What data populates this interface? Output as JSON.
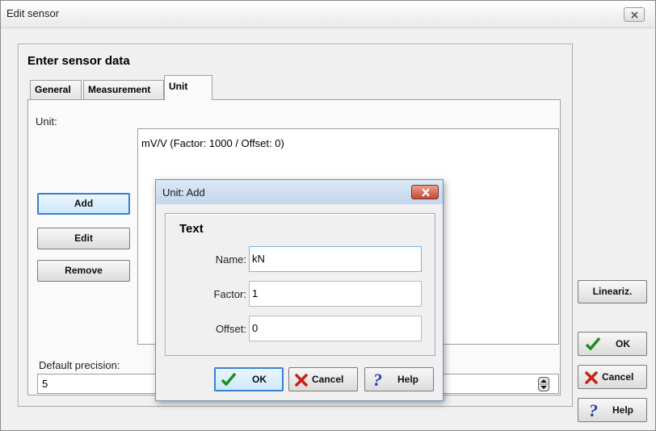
{
  "window": {
    "title": "Edit sensor"
  },
  "panel": {
    "heading": "Enter sensor data"
  },
  "tabs": [
    {
      "label": "General",
      "active": false
    },
    {
      "label": "Measurement",
      "active": false
    },
    {
      "label": "Unit",
      "active": true
    }
  ],
  "unit_tab": {
    "unit_label": "Unit:",
    "unit_list": [
      "mV/V (Factor: 1000 / Offset: 0)"
    ],
    "buttons": {
      "add": "Add",
      "edit": "Edit",
      "remove": "Remove"
    },
    "precision_label": "Default precision:",
    "precision_value": "5"
  },
  "side_buttons": {
    "lineariz": "Lineariz.",
    "ok": "OK",
    "cancel": "Cancel",
    "help": "Help"
  },
  "dialog": {
    "title": "Unit: Add",
    "group_title": "Text",
    "name_label": "Name:",
    "name_value": "kN",
    "factor_label": "Factor:",
    "factor_value": "1",
    "offset_label": "Offset:",
    "offset_value": "0",
    "buttons": {
      "ok": "OK",
      "cancel": "Cancel",
      "help": "Help"
    }
  },
  "colors": {
    "ok_icon": "#1e8c1e",
    "cancel_icon": "#c8201a",
    "help_icon": "#1f3fb0",
    "default_border": "#3c7fd2"
  }
}
